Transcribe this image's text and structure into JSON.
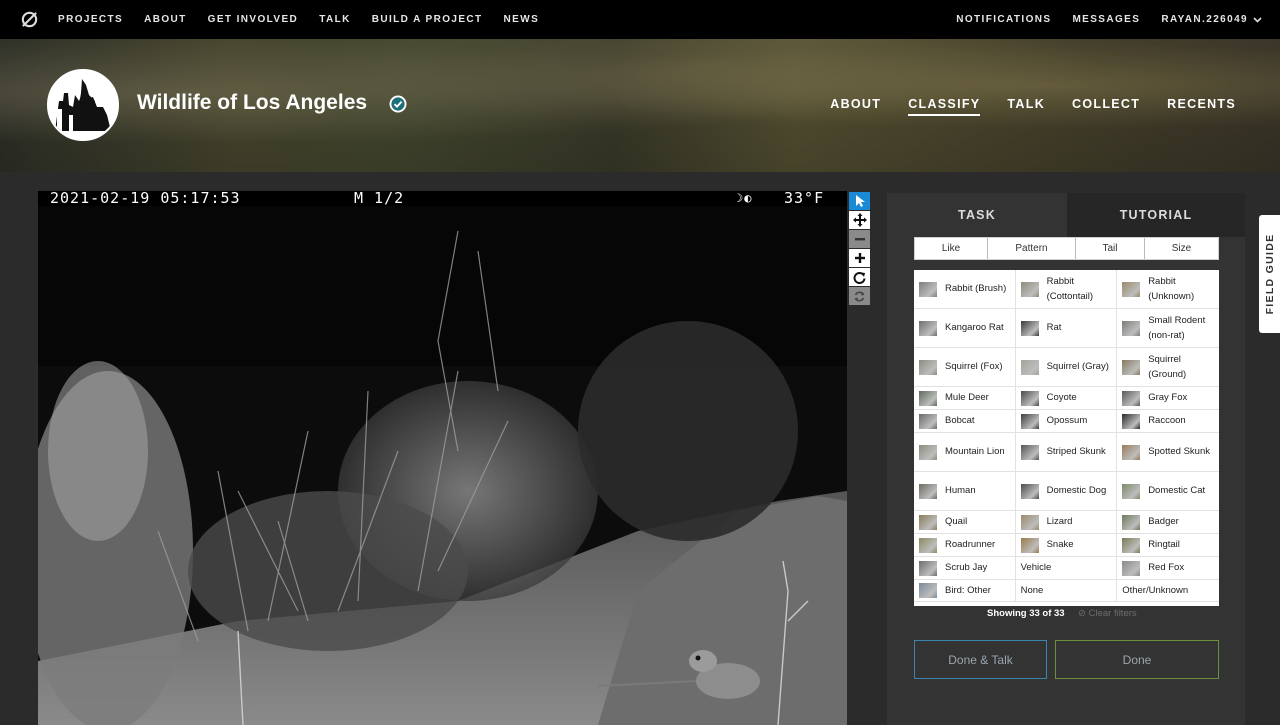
{
  "topnav": {
    "logo_icon": "zooniverse-logo-icon",
    "left_items": [
      "PROJECTS",
      "ABOUT",
      "GET INVOLVED",
      "TALK",
      "BUILD A PROJECT",
      "NEWS"
    ],
    "notifications": "NOTIFICATIONS",
    "messages": "MESSAGES",
    "user": "RAYAN.226049",
    "user_caret_icon": "chevron-down-icon"
  },
  "project": {
    "title": "Wildlife of Los Angeles",
    "verified_icon": "verified-check-icon",
    "nav": [
      "ABOUT",
      "CLASSIFY",
      "TALK",
      "COLLECT",
      "RECENTS"
    ],
    "active_nav": "CLASSIFY"
  },
  "subject": {
    "timestamp": "2021-02-19 05:17:53",
    "mode": "M 1/2",
    "moon": "☽◐",
    "temperature": "33°F"
  },
  "toolbar": {
    "tools": [
      "pointer-icon",
      "pan-icon",
      "zoom-out-icon",
      "zoom-in-icon",
      "rotate-icon",
      "reset-icon"
    ]
  },
  "panel": {
    "tab_task": "TASK",
    "tab_tutorial": "TUTORIAL",
    "filters": [
      "Like",
      "Pattern",
      "Tail",
      "Size"
    ],
    "choices": [
      [
        {
          "label": "Rabbit (Brush)"
        },
        {
          "label": "Rabbit (Cottontail)"
        },
        {
          "label": "Rabbit (Unknown)"
        }
      ],
      [
        {
          "label": "Kangaroo Rat"
        },
        {
          "label": "Rat"
        },
        {
          "label": "Small Rodent (non-rat)"
        }
      ],
      [
        {
          "label": "Squirrel (Fox)"
        },
        {
          "label": "Squirrel (Gray)"
        },
        {
          "label": "Squirrel (Ground)"
        }
      ],
      [
        {
          "label": "Mule Deer"
        },
        {
          "label": "Coyote"
        },
        {
          "label": "Gray Fox"
        }
      ],
      [
        {
          "label": "Bobcat"
        },
        {
          "label": "Opossum"
        },
        {
          "label": "Raccoon"
        }
      ],
      [
        {
          "label": "Mountain Lion"
        },
        {
          "label": "Striped Skunk"
        },
        {
          "label": "Spotted Skunk"
        }
      ],
      [
        {
          "label": "Human"
        },
        {
          "label": "Domestic Dog"
        },
        {
          "label": "Domestic Cat"
        }
      ],
      [
        {
          "label": "Quail"
        },
        {
          "label": "Lizard"
        },
        {
          "label": "Badger"
        }
      ],
      [
        {
          "label": "Roadrunner"
        },
        {
          "label": "Snake"
        },
        {
          "label": "Ringtail"
        }
      ],
      [
        {
          "label": "Scrub Jay"
        },
        {
          "label": "Vehicle"
        },
        {
          "label": "Red Fox"
        }
      ],
      [
        {
          "label": "Bird: Other"
        },
        {
          "label": "None"
        },
        {
          "label": "Other/Unknown"
        }
      ]
    ],
    "showing": "Showing 33 of 33",
    "clear_filters": "Clear filters",
    "done_talk": "Done & Talk",
    "done": "Done",
    "field_guide": "FIELD GUIDE"
  },
  "colors": {
    "accent_blue": "#1a8ad7",
    "done_talk_border": "#3a84ad",
    "done_border": "#6b8f3c"
  }
}
